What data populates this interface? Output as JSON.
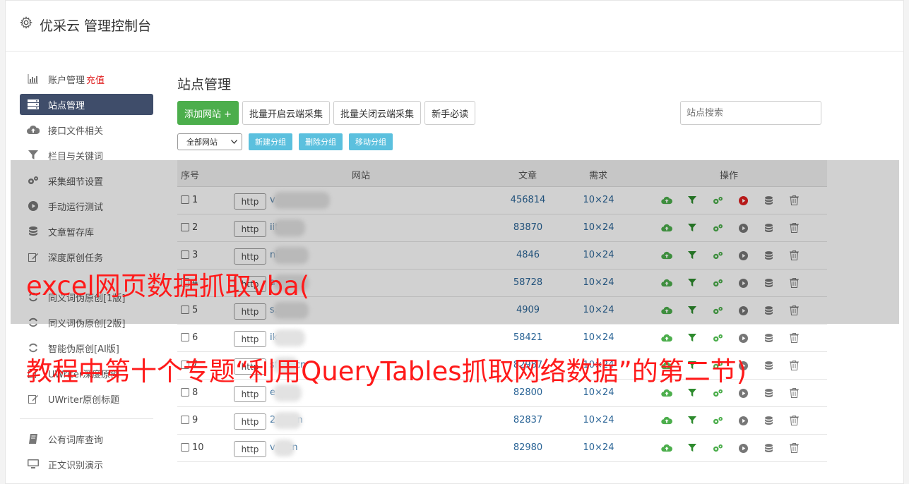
{
  "app_title": "优采云 管理控制台",
  "sidebar": {
    "items": [
      {
        "label": "账户管理",
        "badge": "充值",
        "icon": "bar-chart-icon",
        "active": false
      },
      {
        "label": "站点管理",
        "badge": "",
        "icon": "server-icon",
        "active": true
      },
      {
        "label": "接口文件相关",
        "badge": "",
        "icon": "cloud-upload-icon",
        "active": false
      },
      {
        "label": "栏目与关键词",
        "badge": "",
        "icon": "filter-icon",
        "active": false
      },
      {
        "label": "采集细节设置",
        "badge": "",
        "icon": "gears-icon",
        "active": false
      },
      {
        "label": "手动运行测试",
        "badge": "",
        "icon": "play-circle-icon",
        "active": false
      },
      {
        "label": "文章暂存库",
        "badge": "",
        "icon": "database-icon",
        "active": false
      },
      {
        "label": "深度原创任务",
        "badge": "",
        "icon": "edit-icon",
        "active": false
      },
      {
        "label": "同义词伪原创[1版]",
        "badge": "",
        "icon": "refresh-icon",
        "active": false
      },
      {
        "label": "同义词伪原创[2版]",
        "badge": "",
        "icon": "refresh-icon",
        "active": false
      },
      {
        "label": "智能伪原创[AI版]",
        "badge": "",
        "icon": "refresh-icon",
        "active": false
      },
      {
        "label": "UWriter深度原创",
        "badge": "",
        "icon": "edit-icon",
        "active": false
      },
      {
        "label": "UWriter原创标题",
        "badge": "",
        "icon": "edit-icon",
        "active": false
      },
      {
        "label": "公有词库查询",
        "badge": "",
        "icon": "book-icon",
        "active": false
      },
      {
        "label": "正文识别演示",
        "badge": "",
        "icon": "monitor-icon",
        "active": false
      }
    ]
  },
  "main": {
    "title": "站点管理",
    "toolbar": {
      "add_site": "添加网站 +",
      "batch_enable": "批量开启云端采集",
      "batch_disable": "批量关闭云端采集",
      "beginner": "新手必读"
    },
    "search_placeholder": "站点搜索",
    "group_select": "全部网站",
    "group_buttons": {
      "new": "新建分组",
      "delete": "删除分组",
      "move": "移动分组"
    },
    "table": {
      "headers": {
        "no": "序号",
        "site": "网站",
        "articles": "文章",
        "demand": "需求",
        "actions": "操作"
      },
      "rows": [
        {
          "no": "1",
          "proto": "http",
          "site": "v          .com",
          "articles": "456814",
          "demand": "10×24",
          "run_active": true
        },
        {
          "no": "2",
          "proto": "http",
          "site": "       iit.cn",
          "articles": "83870",
          "demand": "10×24",
          "run_active": false
        },
        {
          "no": "3",
          "proto": "http",
          "site": "       ni.cn",
          "articles": "4846",
          "demand": "10×24",
          "run_active": false
        },
        {
          "no": "4",
          "proto": "http",
          "site": "       av.cn",
          "articles": "58728",
          "demand": "10×24",
          "run_active": false
        },
        {
          "no": "5",
          "proto": "http",
          "site": "       s.cn",
          "articles": "4909",
          "demand": "10×24",
          "run_active": false
        },
        {
          "no": "6",
          "proto": "http",
          "site": "       ik.cn",
          "articles": "58421",
          "demand": "10×24",
          "run_active": false
        },
        {
          "no": "7",
          "proto": "http",
          "site": "sf   39.cn",
          "articles": "82987",
          "demand": "10×24",
          "run_active": false
        },
        {
          "no": "8",
          "proto": "http",
          "site": "e     y.cn",
          "articles": "82800",
          "demand": "10×24",
          "run_active": false
        },
        {
          "no": "9",
          "proto": "http",
          "site": "2    az.cn",
          "articles": "82837",
          "demand": "10×24",
          "run_active": false
        },
        {
          "no": "10",
          "proto": "http",
          "site": "v    p.cn",
          "articles": "82980",
          "demand": "10×24",
          "run_active": false
        }
      ]
    }
  },
  "overlay": {
    "line1": "excel网页数据抓取vba(",
    "line2": "教程中第十个专题“利用QueryTables抓取网络数据”的第二节)"
  },
  "colors": {
    "accent_green": "#4cae4c",
    "active_nav": "#3f4d6a",
    "link_blue": "#2a6496",
    "info_blue": "#5bc0de",
    "overlay_red": "#ff1a1a",
    "run_red": "#e02020"
  }
}
